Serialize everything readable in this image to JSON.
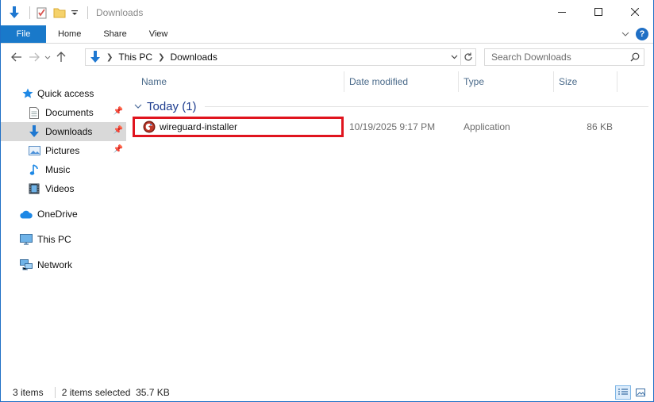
{
  "window": {
    "title": "Downloads"
  },
  "caption": {
    "minimize": "—",
    "maximize": "☐",
    "close": "✕"
  },
  "ribbon": {
    "tabs": [
      "File",
      "Home",
      "Share",
      "View"
    ],
    "help": "?"
  },
  "address": {
    "crumbs": [
      "This PC",
      "Downloads"
    ]
  },
  "search": {
    "placeholder": "Search Downloads"
  },
  "navpane": {
    "items": [
      {
        "label": "Quick access",
        "icon": "star-icon"
      },
      {
        "label": "Documents",
        "icon": "documents-icon",
        "pinned": true
      },
      {
        "label": "Downloads",
        "icon": "download-arrow-icon",
        "pinned": true,
        "selected": true
      },
      {
        "label": "Pictures",
        "icon": "pictures-icon",
        "pinned": true
      },
      {
        "label": "Music",
        "icon": "music-note-icon"
      },
      {
        "label": "Videos",
        "icon": "film-icon"
      },
      {
        "label": "OneDrive",
        "icon": "cloud-icon"
      },
      {
        "label": "This PC",
        "icon": "monitor-icon"
      },
      {
        "label": "Network",
        "icon": "network-icon"
      }
    ]
  },
  "columns": {
    "name": "Name",
    "date": "Date modified",
    "type": "Type",
    "size": "Size"
  },
  "groups": [
    {
      "label": "Today (1)",
      "files": [
        {
          "name": "wireguard-installer",
          "date": "10/19/2025 9:17 PM",
          "type": "Application",
          "size": "86 KB",
          "icon": "wireguard-app-icon"
        }
      ]
    }
  ],
  "status": {
    "count": "3 items",
    "selection": "2 items selected  35.7 KB"
  },
  "colors": {
    "accent": "#1979ca",
    "highlight_border": "#e0141e",
    "group_text": "#1e3d8f"
  }
}
